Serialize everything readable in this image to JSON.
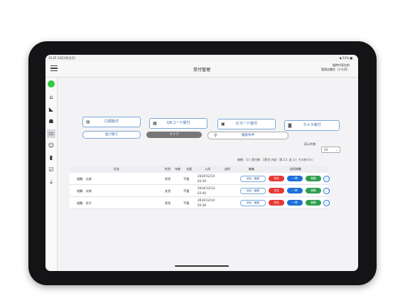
{
  "status_bar": {
    "time": "10:25",
    "date": "12月16日(月)",
    "right": "◆ 51% ■"
  },
  "header": {
    "title": "受付管理",
    "user_line1": "臨時代表名前",
    "user_line2": "管理店舗名（デモ用）"
  },
  "toolbar": {
    "reception_button": "口頭受付",
    "qr_button": "QRコード受付",
    "ic_button": "ICカード受付",
    "camera_button": "カメラ受付",
    "sort_button": "並び替え",
    "clear_button": "クリア",
    "search_button": "検索条件"
  },
  "display": {
    "count_label": "表示件数:",
    "count_value": "10"
  },
  "summary": {
    "line": "総数：3人  受付数：3受付  内訳（男 2人 女 1人 その他 0人）"
  },
  "table": {
    "headers": {
      "name": "氏名",
      "gender": "性別",
      "age": "年齢",
      "support": "支援",
      "entry": "入所",
      "exit": "退所",
      "edit": "編集",
      "move": "退所移動"
    },
    "rows": [
      {
        "name": "避難　太郎",
        "gender": "男性",
        "age": "不要",
        "support": "不要",
        "entry_date": "2024/12/14",
        "entry_time": "03:39",
        "edit": "追加・編集",
        "status": "完全",
        "btn2": "一時",
        "btn3": "移動"
      },
      {
        "name": "避難　次郎",
        "gender": "女性",
        "age": "不要",
        "support": "不要",
        "entry_date": "2024/12/14",
        "entry_time": "03:40",
        "edit": "追加・編集",
        "status": "完全",
        "btn2": "一時",
        "btn3": "移動"
      },
      {
        "name": "避難　花子",
        "gender": "男性",
        "age": "不要",
        "support": "不要",
        "entry_date": "2024/12/14",
        "entry_time": "03:39",
        "edit": "追加・編集",
        "status": "完全",
        "btn2": "一時",
        "btn3": "移動"
      }
    ]
  },
  "colors": {
    "accent": "#1e6fd9",
    "danger": "#e53935",
    "success": "#2e9e4f",
    "online": "#2ecc40"
  },
  "sidebar_icons": [
    "home-icon",
    "megaphone-icon",
    "group-icon",
    "reception-icon",
    "people-icon",
    "chart-icon",
    "checklist-icon",
    "download-icon"
  ]
}
